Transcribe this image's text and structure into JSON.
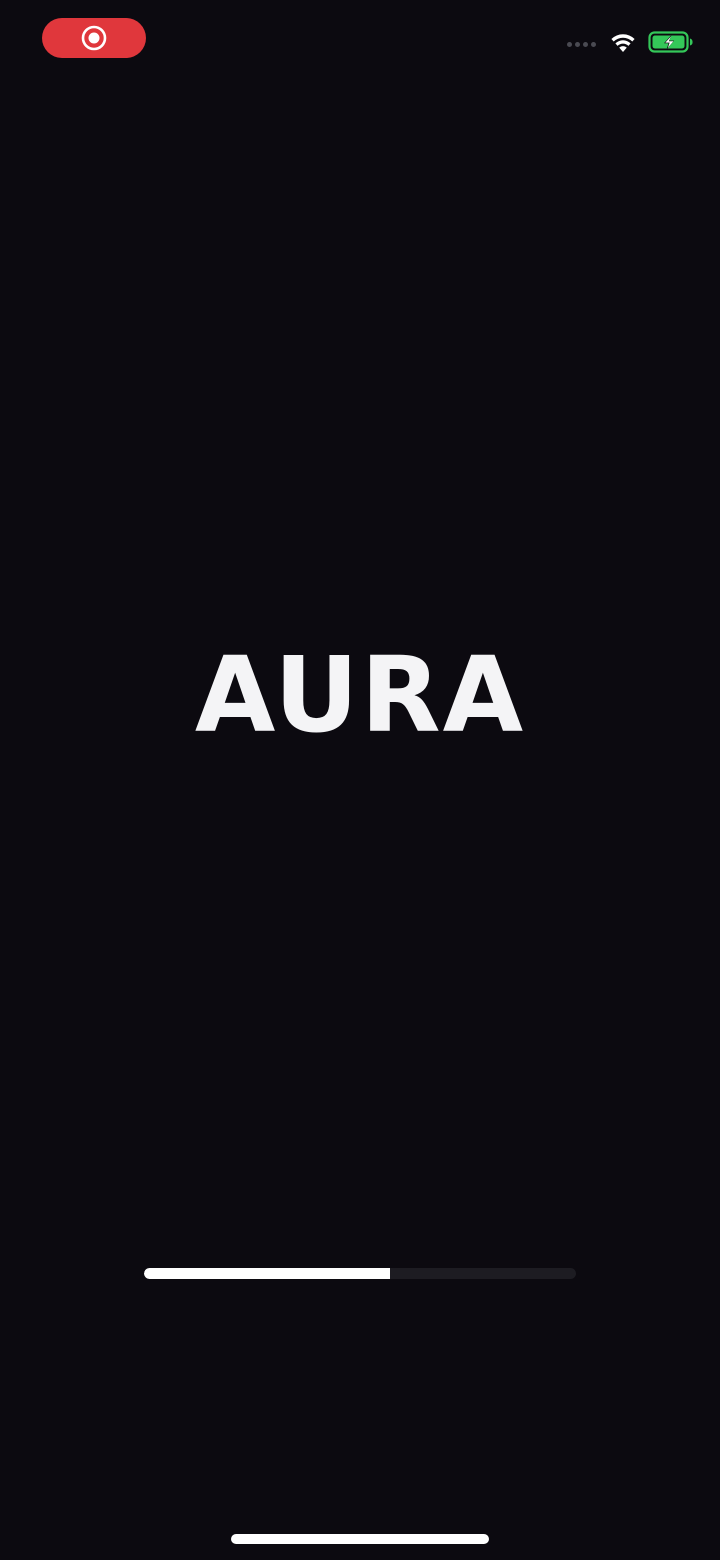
{
  "status_bar": {
    "record_icon": "screen-record-icon",
    "signal_icon": "cellular-signal-icon",
    "wifi_icon": "wifi-icon",
    "battery_icon": "battery-charging-icon",
    "record_color": "#e0373c",
    "battery_color": "#34c759"
  },
  "splash": {
    "logo_text": "AURA",
    "background_color": "#0c0a10",
    "text_color": "#f4f4f6"
  },
  "loading": {
    "progress_percent": 57
  }
}
